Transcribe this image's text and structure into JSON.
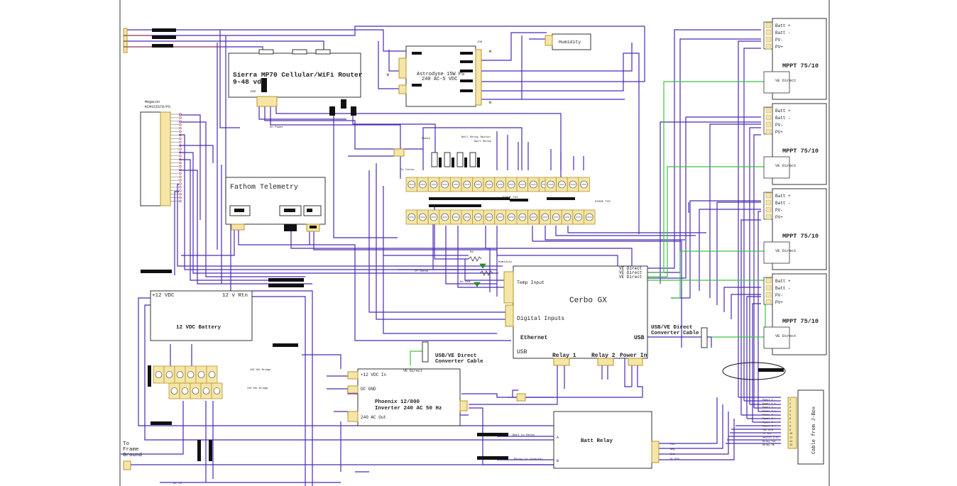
{
  "colors": {
    "wire": "#4b2ab5",
    "wire_red": "#a03050",
    "wire_green": "#3cc43c",
    "box": "#333333",
    "term_fill": "#f5e6a8",
    "term_edge": "#b8962e",
    "black": "#111111"
  },
  "labels": {
    "router_title": "Sierra MP70 Cellular/WiFi Router",
    "router_sub": "9-48 vdc",
    "router_pin": "J28",
    "astro_title": "Astrodyne 15W PS",
    "astro_sub": "240 AC-5 VDC",
    "astro_pin": "J30",
    "humidity": "Humidity",
    "megacon_title": "Megacon",
    "megacon_part": "KCM15IG70/PS",
    "fathom": "Fathom Telemetry",
    "cerbo": "Cerbo GX",
    "cerbo_temp": "Temp Input",
    "cerbo_digital": "Digital Inputs",
    "cerbo_ethernet": "Ethernet",
    "cerbo_usb": "USB",
    "cerbo_usb_left": "USB",
    "cerbo_relay1": "Relay 1",
    "cerbo_relay2": "Relay 2",
    "cerbo_power": "Power In",
    "vedirect": "VE Direct",
    "usb_ve_1": "USB/VE Direct",
    "usb_ve_2": "Converter Cable",
    "battery_pos": "+12 VDC",
    "battery_neg": "12 v Rtn",
    "battery_title": "12 VDC Battery",
    "phoenix_title": "Phoenix 12/800",
    "phoenix_sub": "Inverter 240 AC 50 Hz",
    "phoenix_in": "+12 VDC In",
    "phoenix_gnd": "DC GND",
    "phoenix_out": "240 AC Out",
    "batt_relay": "Batt Relay",
    "batt_to_relay": "Batt to Relay",
    "relay_to_inverter": "Relay to Inverter",
    "frame_ground": [
      "To",
      "Frame",
      "Ground"
    ],
    "mppt_title": "MPPT 75/10",
    "mppt_pins": [
      "Batt +",
      "Batt -",
      "PV-",
      "PV+"
    ],
    "jbox_title": "Cable from J-Box",
    "jbox_pins": [
      "Panel 1 -",
      "Panel 1 +",
      "Panel 2 -",
      "Panel 2 +",
      "Panel 3 -",
      "Panel 3 +",
      "Panel 4 -",
      "Panel 4 +",
      "+DC RTN",
      "+5 VDC",
      "Switch 1/D1",
      "Relay Out",
      "Relay OK"
    ],
    "bus_label_1": "DIODE TVS",
    "bus_label_2": "DIODE TVS",
    "small_dc_power": "Dc Power",
    "small_radio": "Radio",
    "small_ball_relay_switch": "Ball Relay Switch",
    "small_ball_relay": "Ball Relay",
    "small_dc_cerbo": "To Cerbo",
    "small_power_rtn": "Power/RtN",
    "small_humidity": "Humidity",
    "small_cp_sense": "CP Sense",
    "small_r1": "R1",
    "small_r2": "R2",
    "small_dc_rtn": "Dc RtN",
    "small_240ac_1": "240 VAC Bridge",
    "small_240ac_2": "240 VAC Bridge",
    "small_dc_in": "DC In",
    "small_pos": "Pos",
    "small_neg": "Neg",
    "small_gnd": "Gnd",
    "small_dc_rtn2": "DC RTN",
    "small_pwr": "PWR",
    "small_rtn": "RTN",
    "small_dc_rtn3": "DC RTN",
    "small_rtn2": "RTN",
    "small_12v": "+12V",
    "small_pwr2": "PWR"
  }
}
